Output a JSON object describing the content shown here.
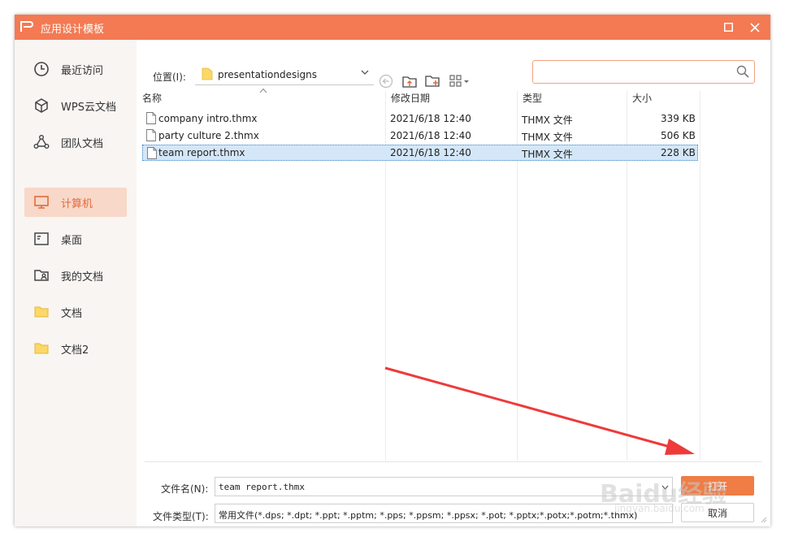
{
  "window": {
    "title": "应用设计模板",
    "accent_color": "#f37a53",
    "controls": {
      "maximize": "maximize-icon",
      "close": "close-icon"
    }
  },
  "sidebar": {
    "items": [
      {
        "label": "最近访问",
        "icon": "clock-icon",
        "active": false
      },
      {
        "label": "WPS云文档",
        "icon": "cube-icon",
        "active": false
      },
      {
        "label": "团队文档",
        "icon": "team-icon",
        "active": false
      },
      {
        "label": "计算机",
        "icon": "monitor-icon",
        "active": true
      },
      {
        "label": "桌面",
        "icon": "desktop-icon",
        "active": false
      },
      {
        "label": "我的文档",
        "icon": "user-folder-icon",
        "active": false
      },
      {
        "label": "文档",
        "icon": "folder-icon",
        "active": false
      },
      {
        "label": "文档2",
        "icon": "folder-icon",
        "active": false
      }
    ]
  },
  "toolbar": {
    "location_label": "位置(I):",
    "location_value": "presentationdesigns",
    "search_placeholder": ""
  },
  "file_list": {
    "columns": [
      "名称",
      "修改日期",
      "类型",
      "大小"
    ],
    "rows": [
      {
        "name": "company intro.thmx",
        "date": "2021/6/18 12:40",
        "type": "THMX 文件",
        "size": "339 KB",
        "selected": false
      },
      {
        "name": "party culture 2.thmx",
        "date": "2021/6/18 12:40",
        "type": "THMX 文件",
        "size": "506 KB",
        "selected": false
      },
      {
        "name": "team report.thmx",
        "date": "2021/6/18 12:40",
        "type": "THMX 文件",
        "size": "228 KB",
        "selected": true
      }
    ]
  },
  "footer": {
    "filename_label": "文件名(N):",
    "filename_value": "team report.thmx",
    "filetype_label": "文件类型(T):",
    "filetype_value": "常用文件(*.dps; *.dpt; *.ppt; *.pptm; *.pps; *.ppsm; *.ppsx; *.pot; *.pptx;*.potx;*.potm;*.thmx)",
    "open_label": "打开",
    "cancel_label": "取消"
  },
  "watermark": {
    "text": "Baidu经验",
    "sub": "jingyan.baidu.com"
  }
}
